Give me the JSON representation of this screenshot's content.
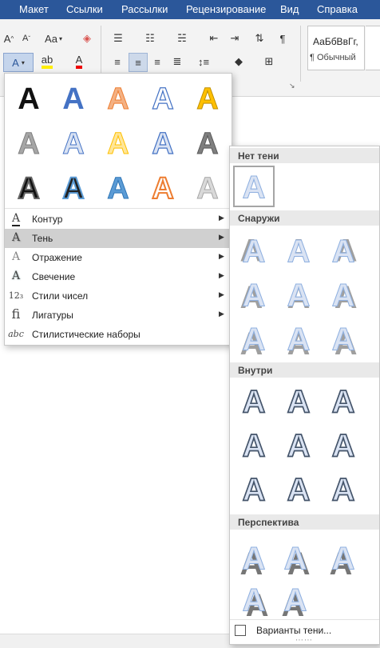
{
  "ribbon_tabs": [
    "Макет",
    "Ссылки",
    "Рассылки",
    "Рецензирование",
    "Вид",
    "Справка"
  ],
  "ribbon": {
    "font_size_case": "Aa",
    "style_sample": "АаБбВвГг,",
    "style_name": "¶ Обычный"
  },
  "text_effects_menu": {
    "items": [
      {
        "label": "Контур",
        "icon": "outline-icon"
      },
      {
        "label": "Тень",
        "icon": "shadow-icon"
      },
      {
        "label": "Отражение",
        "icon": "reflection-icon"
      },
      {
        "label": "Свечение",
        "icon": "glow-icon"
      },
      {
        "label": "Стили чисел",
        "icon": "number-styles-icon"
      },
      {
        "label": "Лигатуры",
        "icon": "ligatures-icon"
      },
      {
        "label": "Стилистические наборы",
        "icon": "stylistic-sets-icon"
      }
    ],
    "active_item": "Тень"
  },
  "shadow_submenu": {
    "sections": [
      "Нет тени",
      "Снаружи",
      "Внутри",
      "Перспектива"
    ],
    "variants_label": "Варианты тени..."
  },
  "colors": {
    "ribbon_tab_bg": "#2b579a",
    "menu_active_bg": "#d0d0d0",
    "section_header_bg": "#e9e9e9",
    "accent_blue": "#4472c4"
  }
}
